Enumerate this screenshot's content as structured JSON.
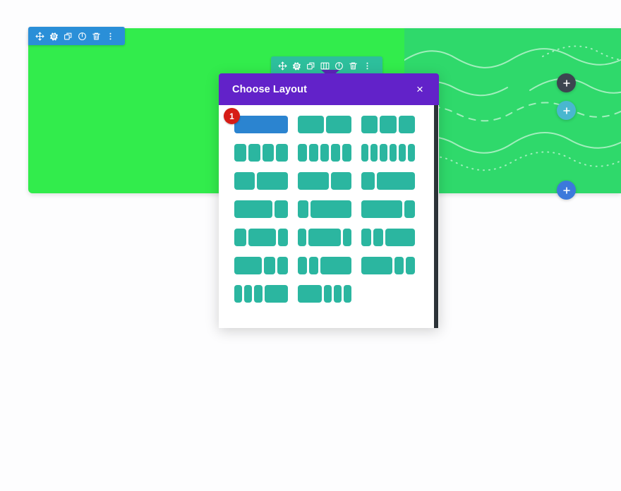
{
  "page": {
    "background_color": "#fdfdfe"
  },
  "section": {
    "name": "page-section",
    "background_color": "#32ec4c",
    "toolbar": {
      "background_color": "#2a8fd8",
      "icons": [
        {
          "name": "move-icon",
          "label": "Move Section"
        },
        {
          "name": "gear-icon",
          "label": "Section Settings"
        },
        {
          "name": "duplicate-icon",
          "label": "Duplicate Section"
        },
        {
          "name": "power-icon",
          "label": "Disable Section"
        },
        {
          "name": "trash-icon",
          "label": "Delete Section"
        },
        {
          "name": "more-options-icon",
          "label": "More Options"
        }
      ]
    }
  },
  "row": {
    "name": "page-row",
    "background_color": "#2fd96b",
    "toolbar": {
      "background_color": "#2dbf9c",
      "icons": [
        {
          "name": "move-icon",
          "label": "Move Row"
        },
        {
          "name": "gear-icon",
          "label": "Row Settings"
        },
        {
          "name": "duplicate-icon",
          "label": "Duplicate Row"
        },
        {
          "name": "columns-layout-icon",
          "label": "Change Column Structure",
          "active": true
        },
        {
          "name": "power-icon",
          "label": "Disable Row"
        },
        {
          "name": "trash-icon",
          "label": "Delete Row"
        },
        {
          "name": "more-options-icon",
          "label": "More Options"
        }
      ]
    }
  },
  "modal": {
    "title": "Choose Layout",
    "close_label": "×",
    "header_color": "#6222c9",
    "selected_color": "#2b84d0",
    "option_color": "#2bb6a0",
    "badge": {
      "text": "1",
      "color": "#d61c16"
    },
    "layouts": [
      {
        "id": "1-col",
        "columns": [
          1
        ],
        "selected": true
      },
      {
        "id": "2-col",
        "columns": [
          1,
          1
        ],
        "selected": false
      },
      {
        "id": "3-col",
        "columns": [
          1,
          1,
          1
        ],
        "selected": false
      },
      {
        "id": "4-col",
        "columns": [
          1,
          1,
          1,
          1
        ],
        "selected": false
      },
      {
        "id": "5-col",
        "columns": [
          1,
          1,
          1,
          1,
          1
        ],
        "selected": false
      },
      {
        "id": "6-col",
        "columns": [
          1,
          1,
          1,
          1,
          1,
          1
        ],
        "selected": false
      },
      {
        "id": "1_3-2_3",
        "columns": [
          2,
          3
        ],
        "selected": false
      },
      {
        "id": "2_3-1_3",
        "columns": [
          3,
          2
        ],
        "selected": false
      },
      {
        "id": "1_4-3_4",
        "columns": [
          1.4,
          4
        ],
        "selected": false
      },
      {
        "id": "3_4-1_4",
        "columns": [
          4,
          1.4
        ],
        "selected": false
      },
      {
        "id": "1_4-3_4-b",
        "columns": [
          1.2,
          4.5
        ],
        "selected": false
      },
      {
        "id": "3_4-1_4-b",
        "columns": [
          4.5,
          1.2
        ],
        "selected": false
      },
      {
        "id": "1_4-1_2-1_4",
        "columns": [
          1.3,
          3,
          1.1
        ],
        "selected": false
      },
      {
        "id": "1_6-2_3-1_6",
        "columns": [
          1,
          4,
          1
        ],
        "selected": false
      },
      {
        "id": "1_6-1_6-2_3",
        "columns": [
          1,
          1,
          3
        ],
        "selected": false
      },
      {
        "id": "1_2-1_4-1_4",
        "columns": [
          3.1,
          1.2,
          1.2
        ],
        "selected": false
      },
      {
        "id": "1_6-1_6-2_3-b",
        "columns": [
          1,
          1,
          3.3
        ],
        "selected": false
      },
      {
        "id": "1_2-1_4-1_4-b",
        "columns": [
          3.3,
          1,
          1
        ],
        "selected": false
      },
      {
        "id": "1_6x3-1_2",
        "columns": [
          1,
          1,
          1,
          3
        ],
        "selected": false
      },
      {
        "id": "1_2-1_6x3",
        "columns": [
          3,
          1,
          1,
          1
        ],
        "selected": false
      }
    ]
  },
  "add_buttons": [
    {
      "name": "add-section-button",
      "label": "+",
      "color": "#3c4550"
    },
    {
      "name": "add-row-button",
      "label": "+",
      "color": "#49b7cf"
    },
    {
      "name": "add-module-button",
      "label": "+",
      "color": "#3c79db"
    }
  ]
}
